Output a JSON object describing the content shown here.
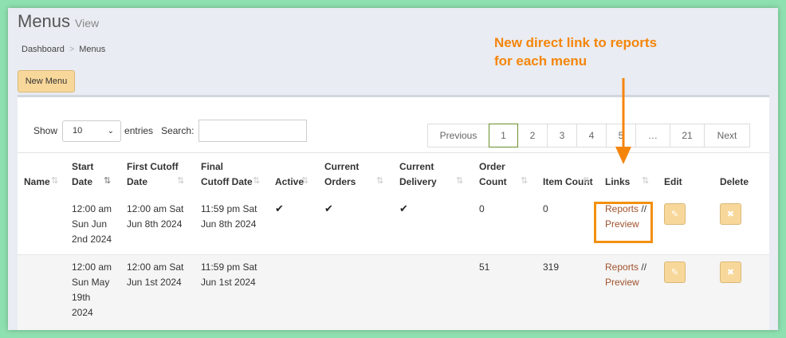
{
  "page": {
    "title": "Menus",
    "subtitle": "View"
  },
  "breadcrumb": {
    "home": "Dashboard",
    "separator": ">",
    "current": "Menus"
  },
  "actions": {
    "new_menu": "New Menu"
  },
  "table_controls": {
    "show_label": "Show",
    "page_size": "10",
    "entries_label": "entries",
    "search_label": "Search:",
    "search_value": ""
  },
  "pagination": {
    "previous": "Previous",
    "pages": [
      "1",
      "2",
      "3",
      "4",
      "5",
      "…",
      "21"
    ],
    "next": "Next",
    "current": "1"
  },
  "columns": {
    "name": "Name",
    "start_date": "Start Date",
    "first_cutoff": "First Cutoff Date",
    "final_cutoff": "Final Cutoff Date",
    "active": "Active",
    "current_orders": "Current Orders",
    "current_delivery": "Current Delivery",
    "order_count": "Order Count",
    "item_count": "Item Count",
    "links": "Links",
    "edit": "Edit",
    "delete": "Delete"
  },
  "rows": [
    {
      "start": [
        "12:00 am",
        "Sun Jun",
        "2nd 2024"
      ],
      "first_cutoff": [
        "12:00 am Sat",
        "Jun 8th 2024"
      ],
      "final_cutoff": [
        "11:59 pm Sat",
        "Jun 8th 2024"
      ],
      "active": true,
      "current_orders": true,
      "current_delivery": true,
      "order_count": "0",
      "item_count": "0",
      "link_reports": "Reports",
      "link_sep": " //",
      "link_preview": "Preview"
    },
    {
      "start": [
        "12:00 am",
        "Sun May",
        "19th",
        "2024"
      ],
      "first_cutoff": [
        "12:00 am Sat",
        "Jun 1st 2024"
      ],
      "final_cutoff": [
        "11:59 pm Sat",
        "Jun 1st 2024"
      ],
      "active": false,
      "current_orders": false,
      "current_delivery": false,
      "order_count": "51",
      "item_count": "319",
      "link_reports": "Reports",
      "link_sep": " //",
      "link_preview": "Preview"
    }
  ],
  "annotation": {
    "line1": "New direct link to reports",
    "line2": "for each menu"
  },
  "colors": {
    "accent_button": "#f8d89a",
    "link": "#a0522d",
    "annotation": "#f5850a",
    "active_page_border": "#6b8e2a",
    "background": "#8fe0b0"
  },
  "icons": {
    "check": "check-icon",
    "edit": "pencil-icon",
    "delete": "x-icon",
    "sort": "sort-arrows-icon",
    "sort_active": "sort-desc-icon",
    "chevron": "chevron-down-icon"
  }
}
